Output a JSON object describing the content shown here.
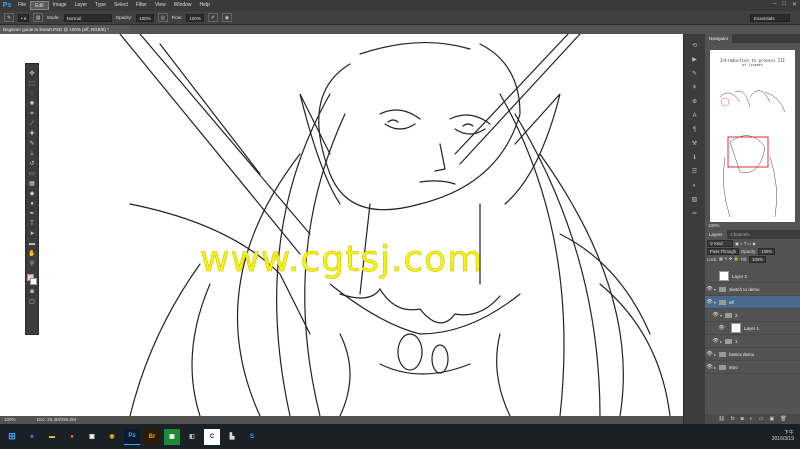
{
  "app": {
    "logo": "Ps"
  },
  "menu": [
    "File",
    "Edit",
    "Image",
    "Layer",
    "Type",
    "Select",
    "Filter",
    "View",
    "Window",
    "Help"
  ],
  "window_controls": {
    "minimize": "–",
    "maximize": "□",
    "close": "✕"
  },
  "options": {
    "mode_label": "Mode:",
    "mode_value": "Normal",
    "opacity_label": "Opacity:",
    "opacity_value": "100%",
    "flow_label": "Flow:",
    "flow_value": "100%",
    "workspace": "Essentials"
  },
  "document_tab": "Beginner guide to lineart.PSD @ 100% (elf, RGB/8) *",
  "status": "Doc: 25.3M/356.0M",
  "watermark": "www.cgtsj.com",
  "navigator": {
    "tab": "Navigator",
    "thumb_title": "Introduction to process III",
    "thumb_subtitle": "of lineart",
    "zoom": "100%"
  },
  "layers_panel": {
    "tab_layers": "Layers",
    "tab_channels": "Channels",
    "kind": "Kind",
    "blend": "Pass Through",
    "opacity_label": "Opacity:",
    "opacity_value": "100%",
    "lock_label": "Lock:",
    "fill_label": "Fill:",
    "fill_value": "100%",
    "layers": [
      {
        "name": "Layer 2",
        "type": "layer"
      },
      {
        "name": "sketch to demo",
        "type": "folder"
      },
      {
        "name": "elf",
        "type": "folder",
        "selected": true
      },
      {
        "name": "2",
        "type": "folder"
      },
      {
        "name": "Layer 1",
        "type": "layer"
      },
      {
        "name": "1",
        "type": "folder"
      },
      {
        "name": "basics demo",
        "type": "folder"
      },
      {
        "name": "intro",
        "type": "folder"
      }
    ]
  },
  "taskbar": {
    "time": "下午",
    "date": "2016/3/19"
  },
  "colors": {
    "foreground": "#f2c8c8",
    "background": "#ffffff",
    "accent": "#31a8ff"
  }
}
